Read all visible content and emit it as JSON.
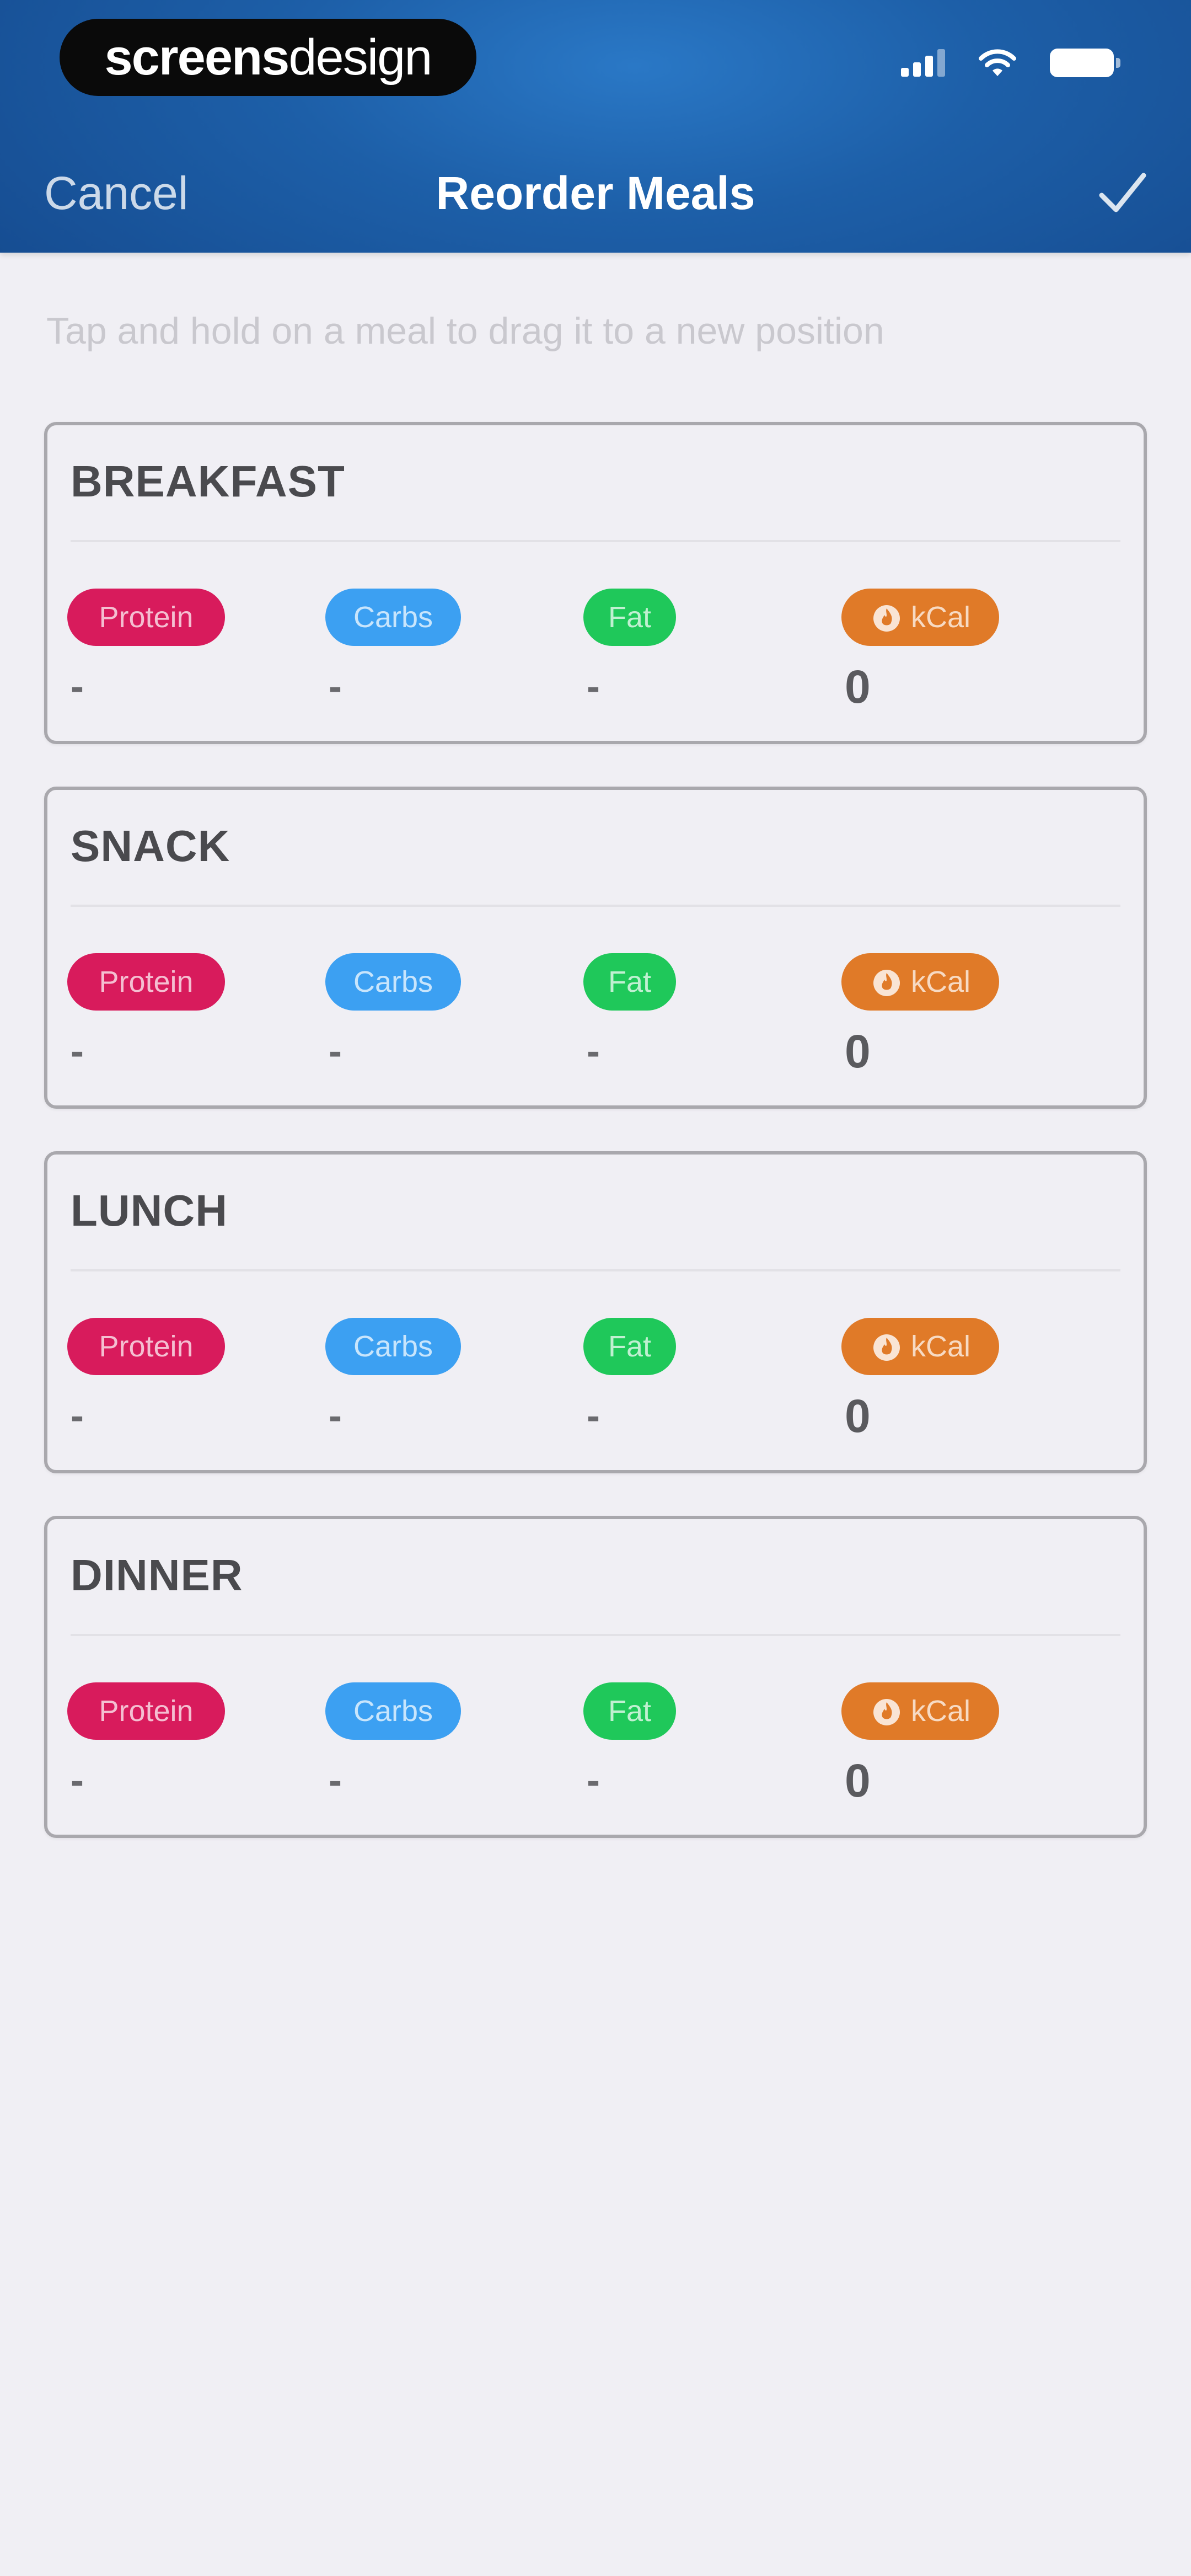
{
  "status_bar": {
    "brand_bold": "screens",
    "brand_light": "design",
    "icons": [
      "signal-icon",
      "wifi-icon",
      "battery-icon"
    ]
  },
  "nav": {
    "cancel_label": "Cancel",
    "title": "Reorder Meals",
    "confirm_icon": "checkmark-icon"
  },
  "hint": "Tap and hold on a meal to drag it to a new position",
  "macro_labels": {
    "protein": "Protein",
    "carbs": "Carbs",
    "fat": "Fat",
    "kcal": "kCal"
  },
  "meals": [
    {
      "title": "BREAKFAST",
      "protein": "-",
      "carbs": "-",
      "fat": "-",
      "kcal": "0"
    },
    {
      "title": "SNACK",
      "protein": "-",
      "carbs": "-",
      "fat": "-",
      "kcal": "0"
    },
    {
      "title": "LUNCH",
      "protein": "-",
      "carbs": "-",
      "fat": "-",
      "kcal": "0"
    },
    {
      "title": "DINNER",
      "protein": "-",
      "carbs": "-",
      "fat": "-",
      "kcal": "0"
    }
  ],
  "colors": {
    "header_blue": "#1d5fa8",
    "protein": "#d81b5c",
    "carbs": "#3ca0f2",
    "fat": "#1fc85a",
    "kcal": "#e07a28",
    "background": "#f0eff4"
  }
}
